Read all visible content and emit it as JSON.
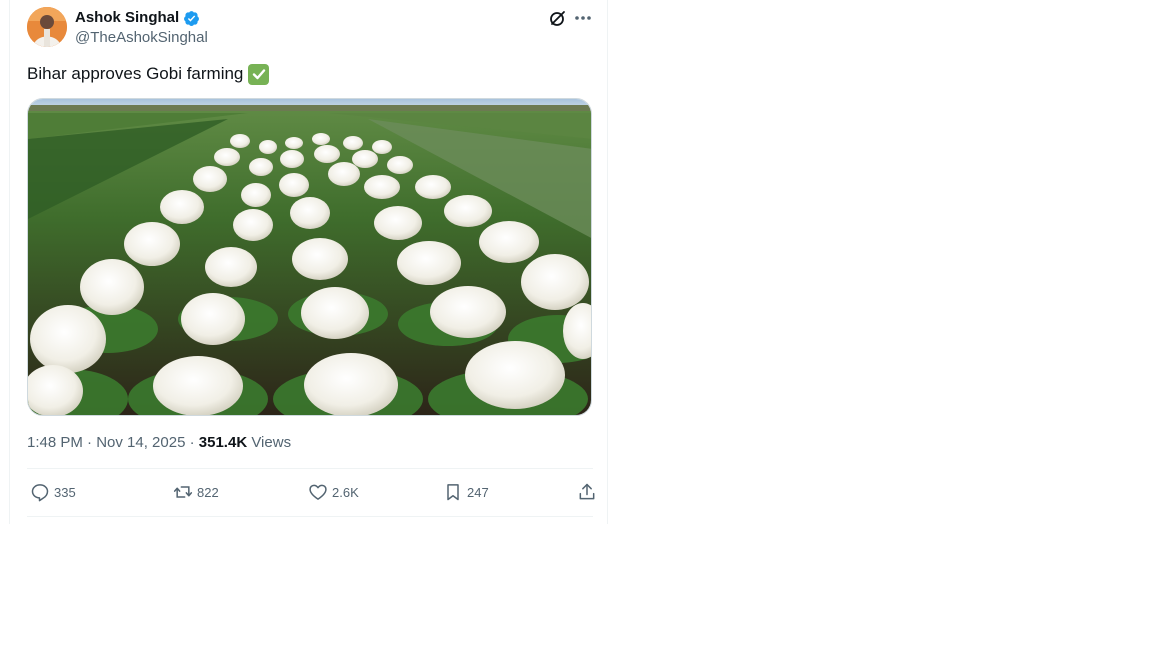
{
  "tweet": {
    "author_name": "Ashok Singhal",
    "author_handle": "@TheAshokSinghal",
    "text": "Bihar approves Gobi farming",
    "timestamp": "1:48 PM · Nov 14, 2025",
    "views_count": "351.4K",
    "views_label": "Views",
    "icons": {
      "verified": "verified-badge-icon",
      "grok": "grok-icon",
      "more": "more-icon",
      "check": "check-mark-emoji"
    }
  },
  "actions": {
    "replies": "335",
    "reposts": "822",
    "likes": "2.6K",
    "bookmarks": "247"
  },
  "colors": {
    "verified_blue": "#1d9bf0",
    "secondary_text": "#536471",
    "check_green": "#77b255"
  }
}
